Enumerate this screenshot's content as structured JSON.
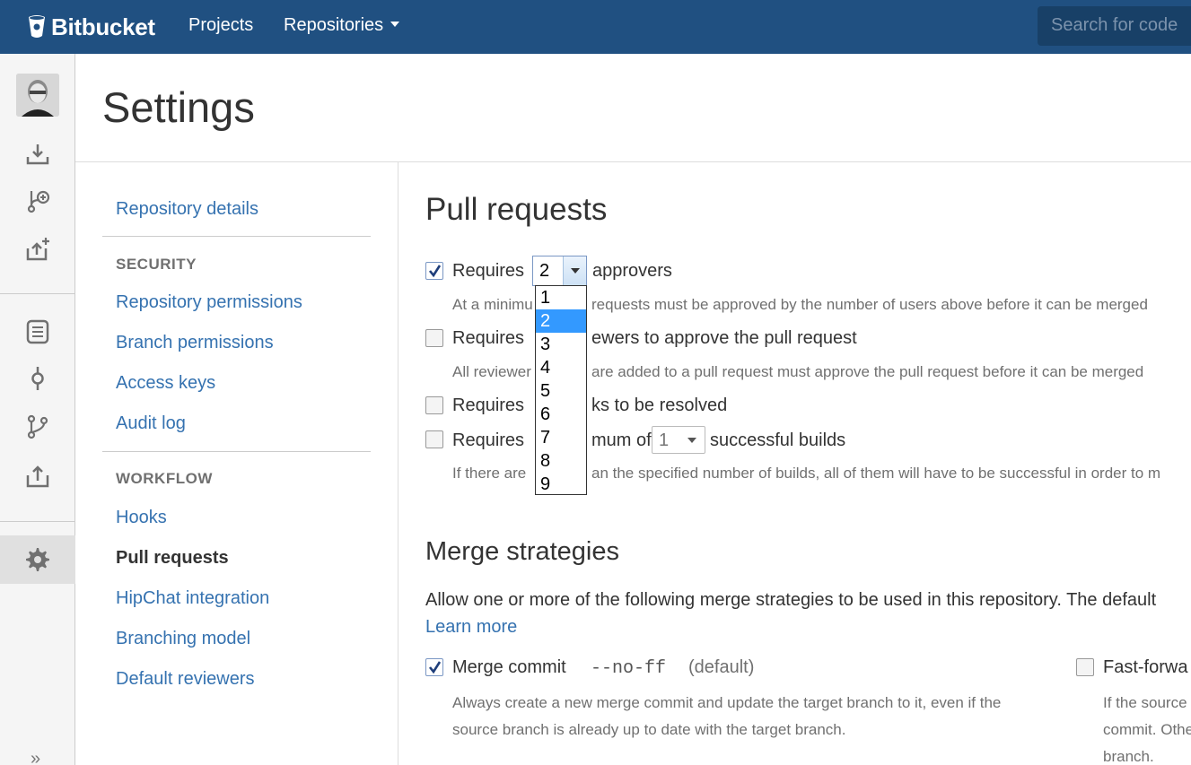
{
  "header": {
    "logo_text": "Bitbucket",
    "nav": [
      {
        "label": "Projects"
      },
      {
        "label": "Repositories"
      }
    ],
    "search_placeholder": "Search for code"
  },
  "page": {
    "title": "Settings"
  },
  "settings_nav": {
    "repository_details": "Repository details",
    "security_heading": "SECURITY",
    "security_items": [
      "Repository permissions",
      "Branch permissions",
      "Access keys",
      "Audit log"
    ],
    "workflow_heading": "WORKFLOW",
    "workflow_items": [
      "Hooks",
      "Pull requests",
      "HipChat integration",
      "Branching model",
      "Default reviewers"
    ],
    "active_item": "Pull requests"
  },
  "pull_requests": {
    "title": "Pull requests",
    "approvers": {
      "checked": true,
      "label_before": "Requires",
      "selected_value": "2",
      "label_after": "approvers",
      "help_left": "At a minimu",
      "help_right": "requests must be approved by the number of users above before it can be merged",
      "options": [
        "1",
        "2",
        "3",
        "4",
        "5",
        "6",
        "7",
        "8",
        "9"
      ]
    },
    "reviewers": {
      "checked": false,
      "label_left": "Requires",
      "label_right": "ewers to approve the pull request",
      "help_left": "All reviewer",
      "help_right": "are added to a pull request must approve the pull request before it can be merged"
    },
    "tasks": {
      "checked": false,
      "label_left": "Requires",
      "label_right": "ks to be resolved"
    },
    "builds": {
      "checked": false,
      "label_left": "Requires",
      "label_mid": "mum of",
      "selected_value": "1",
      "label_after": "successful builds",
      "help_left": "If there are",
      "help_right": "an the specified number of builds, all of them will have to be successful in order to m"
    }
  },
  "merge_strategies": {
    "title": "Merge strategies",
    "description": "Allow one or more of the following merge strategies to be used in this repository. The default",
    "learn_more": "Learn more",
    "merge_commit": {
      "checked": true,
      "label": "Merge commit",
      "flag": "--no-ff",
      "default_tag": "(default)",
      "help_line1": "Always create a new merge commit and update the target branch to it, even if the",
      "help_line2": "source branch is already up to date with the target branch."
    },
    "fast_forward": {
      "checked": false,
      "label": "Fast-forwa",
      "help_line1": "If the source",
      "help_line2": "commit. Othe",
      "help_line3": "branch."
    }
  },
  "rail": {
    "collapse_label": "»"
  }
}
